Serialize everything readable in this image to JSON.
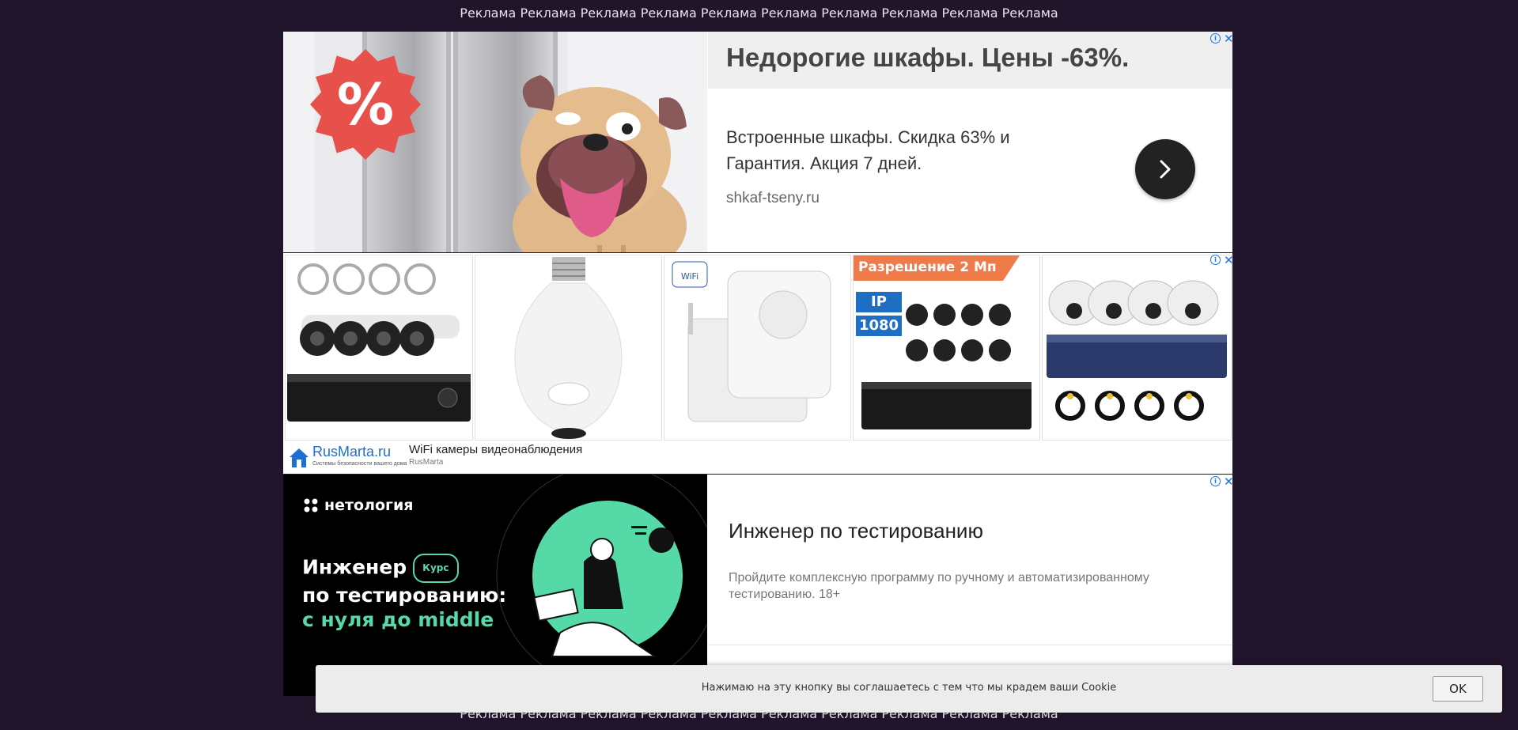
{
  "top_banner": {
    "text": "Реклама Реклама Реклама Реклама Реклама Реклама Реклама Реклама Реклама Реклама"
  },
  "bottom_banner": {
    "text": "Реклама Реклама Реклама Реклама Реклама Реклама Реклама Реклама Реклама Реклама"
  },
  "ad1": {
    "badge": "%",
    "title": "Недорогие шкафы. Цены -63%.",
    "description": "Встроенные шкафы. Скидка 63% и Гарантия. Акция 7 дней.",
    "url": "shkaf-tseny.ru",
    "cta_icon": "chevron-right-icon"
  },
  "ad2": {
    "tiles": [
      {
        "label": "",
        "icon": "camera-kit-image"
      },
      {
        "label": "",
        "icon": "bulb-camera-image"
      },
      {
        "label": "WiFi",
        "icon": "wifi-plug-image"
      },
      {
        "label": "Разрешение 2 Мп",
        "ip_tag": "IP",
        "res_tag": "1080",
        "icon": "ip-camera-kit-image"
      },
      {
        "label": "",
        "icon": "dome-camera-kit-image"
      }
    ],
    "logo_text": "RusMarta.ru",
    "logo_tagline": "Системы безопасности вашего дома",
    "title": "WiFi камеры видеонаблюдения",
    "advertiser": "RusMarta"
  },
  "ad3": {
    "brand": "нетология",
    "headline_line1": "Инженер",
    "badge": "Курс",
    "headline_line2": "по тестированию:",
    "headline_line3": "с нуля до middle",
    "title": "Инженер по тестированию",
    "description": "Пройдите комплексную программу по ручному и автоматизированному тестированию. 18+"
  },
  "cookie": {
    "text": "Нажимаю на эту кнопку вы соглашаетесь с тем что мы крадем ваши Cookie",
    "ok_label": "OK"
  },
  "colors": {
    "background": "#21152b",
    "badge": "#e8514b",
    "netology_green": "#55d9a6",
    "adchoice_blue": "#1a73e8"
  }
}
